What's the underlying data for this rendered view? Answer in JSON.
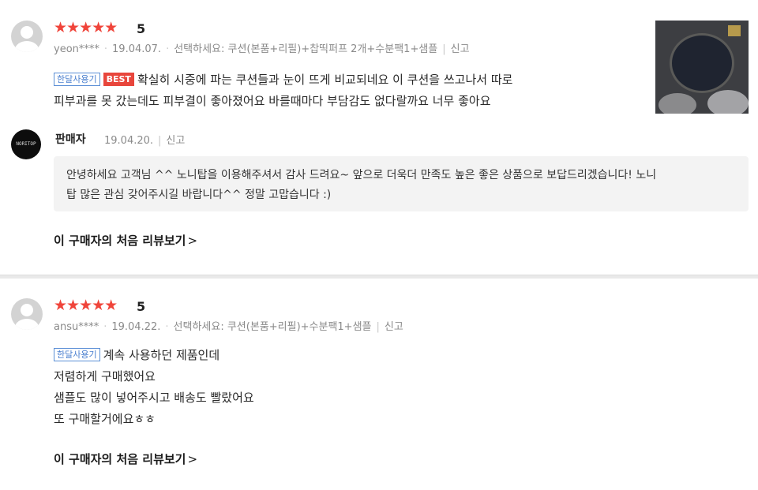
{
  "reviews": [
    {
      "rating_stars": "★★★★★",
      "rating_value": "5",
      "user": "yeon****",
      "date": "19.04.07.",
      "option": "선택하세요: 쿠션(본품+리필)+찹띡퍼프 2개+수분팩1+샘플",
      "report": "신고",
      "badges": {
        "month": "한달사용기",
        "best": "BEST"
      },
      "text_lines": [
        "확실히 시중에 파는 쿠션들과 눈이 뜨게 비교되네요 이 쿠션을 쓰고나서 따로",
        "피부과를 못 갔는데도 피부결이 좋아졌어요 바를때마다 부담감도 없다랄까요 너무 좋아요"
      ],
      "seller_reply": {
        "avatar_text": "NORITOP",
        "name": "판매자",
        "date": "19.04.20.",
        "report": "신고",
        "text_lines": [
          "안녕하세요 고객님 ^^ 노니탑을 이용해주셔서 감사 드려요~ 앞으로 더욱더 만족도 높은 좋은 상품으로 보답드리겠습니다! 노니",
          "탑 많은 관심 갖어주시길 바랍니다^^ 정말 고맙습니다 :)"
        ]
      },
      "first_review_link": "이 구매자의 처음 리뷰보기",
      "first_review_chevron": ">"
    },
    {
      "rating_stars": "★★★★★",
      "rating_value": "5",
      "user": "ansu****",
      "date": "19.04.22.",
      "option": "선택하세요: 쿠션(본품+리필)+수분팩1+샘플",
      "report": "신고",
      "badges": {
        "month": "한달사용기"
      },
      "text_lines": [
        "계속 사용하던 제품인데",
        "저렴하게 구매했어요",
        "샘플도 많이 넣어주시고 배송도 빨랐어요",
        "또 구매할거에요ㅎㅎ"
      ],
      "first_review_link": "이 구매자의 처음 리뷰보기",
      "first_review_chevron": ">"
    }
  ],
  "colors": {
    "star": "#f0443a",
    "best_badge": "#e8463c",
    "month_badge": "#4a7fcf",
    "reply_bg": "#f3f3f3"
  }
}
